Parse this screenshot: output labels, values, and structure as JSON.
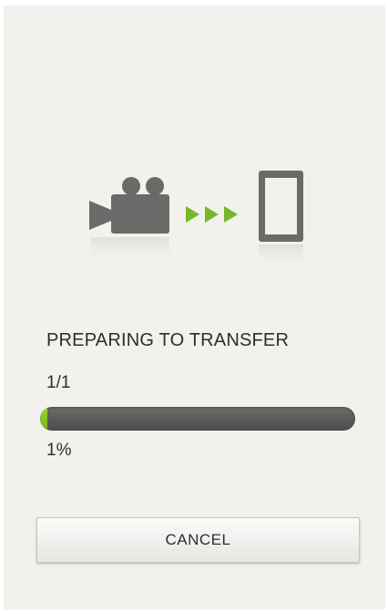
{
  "transfer": {
    "source_icon": "video-camera-icon",
    "direction_icon": "arrows-right-icon",
    "target_icon": "smartphone-icon",
    "arrow_color": "#76b82a",
    "icon_color": "#6b6a68"
  },
  "status": {
    "message": "PREPARING TO TRANSFER",
    "count": "1/1"
  },
  "progress": {
    "percent_label": "1%",
    "value_percent": 1,
    "fill_color": "#8cc63f",
    "track_color": "#5a5957"
  },
  "actions": {
    "cancel_label": "CANCEL"
  }
}
